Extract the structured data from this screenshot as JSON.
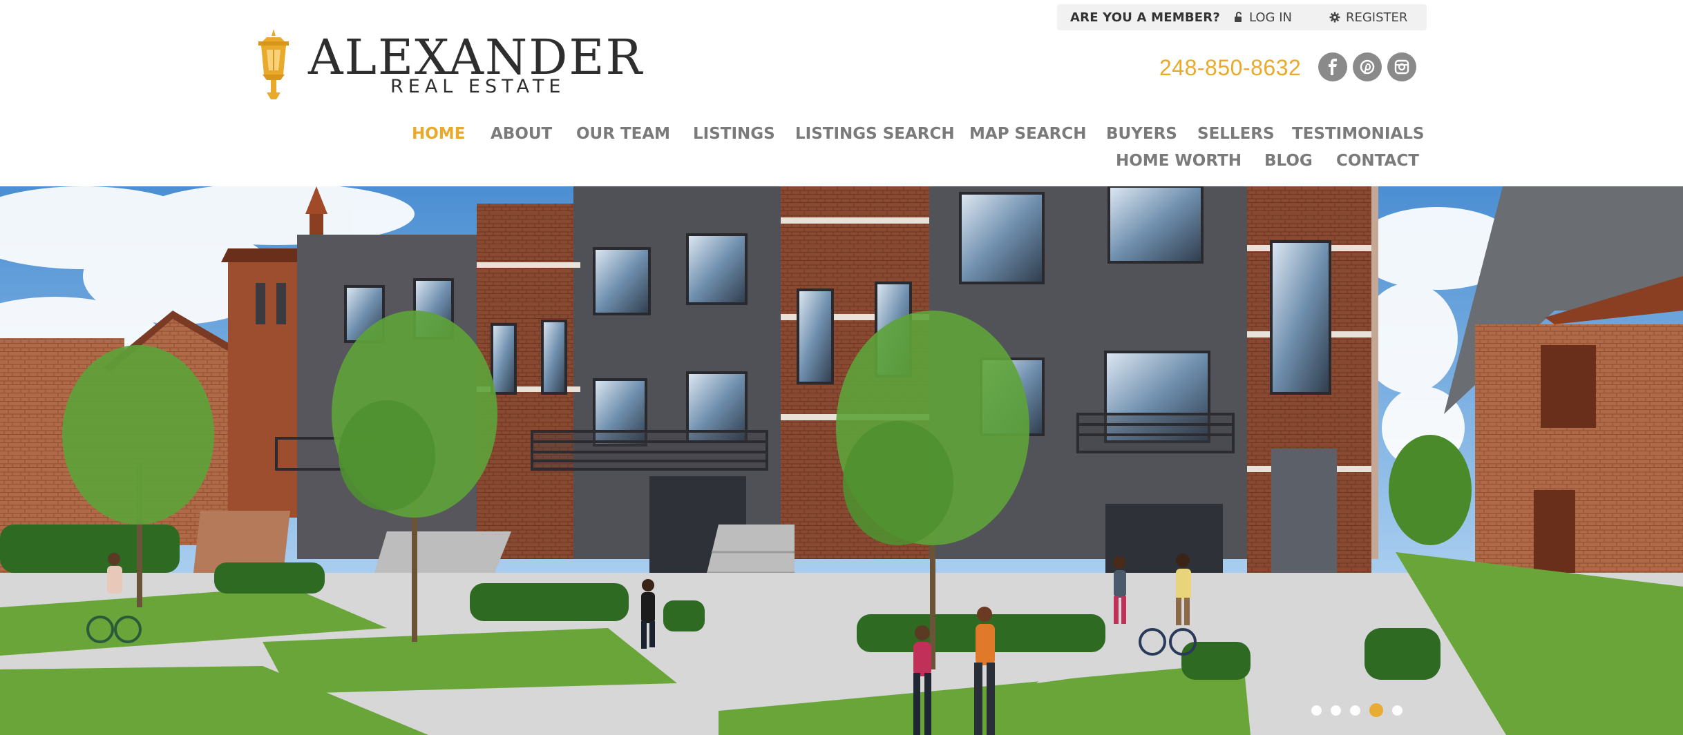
{
  "member_bar": {
    "question": "ARE YOU A MEMBER?",
    "login_label": "LOG IN",
    "login_icon": "unlock-icon",
    "register_label": "REGISTER",
    "register_icon": "gear-icon"
  },
  "logo": {
    "name": "ALEXANDER",
    "subtitle": "REAL ESTATE",
    "icon": "lantern-icon",
    "accent_color": "#e9a92a"
  },
  "contact": {
    "phone": "248-850-8632"
  },
  "social": [
    {
      "name": "facebook-icon"
    },
    {
      "name": "pinterest-icon"
    },
    {
      "name": "instagram-icon"
    }
  ],
  "nav": {
    "items": [
      {
        "label": "HOME",
        "active": true
      },
      {
        "label": "ABOUT"
      },
      {
        "label": "OUR TEAM"
      },
      {
        "label": "LISTINGS"
      },
      {
        "label": "LISTINGS SEARCH"
      },
      {
        "label": "MAP SEARCH"
      },
      {
        "label": "BUYERS"
      },
      {
        "label": "SELLERS"
      },
      {
        "label": "TESTIMONIALS"
      },
      {
        "label": "HOME WORTH"
      },
      {
        "label": "BLOG"
      },
      {
        "label": "CONTACT"
      }
    ]
  },
  "hero": {
    "description": "townhouse rendering slideshow",
    "slides": 5,
    "active_slide": 4
  },
  "colors": {
    "accent": "#e9a92a",
    "nav_text": "#7a7a7a",
    "brick": "#8a4a32",
    "panel": "#56565c"
  }
}
